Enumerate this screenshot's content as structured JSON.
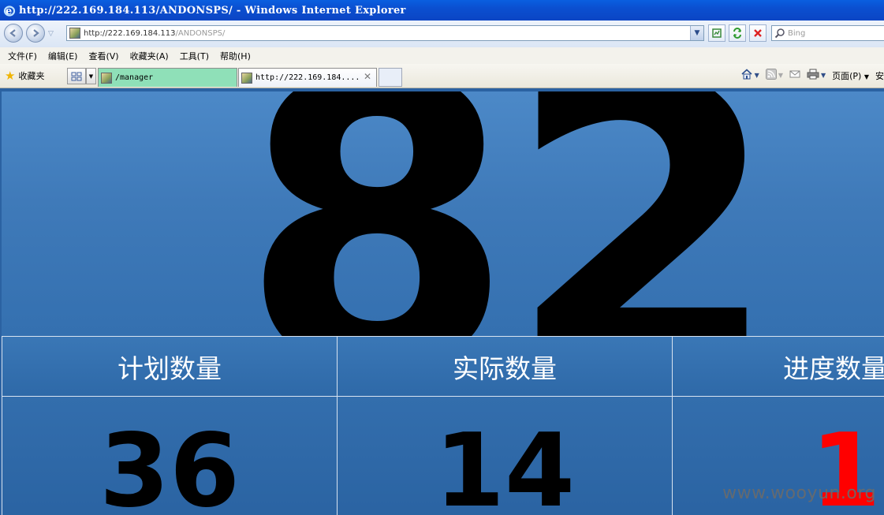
{
  "window": {
    "title": "http://222.169.184.113/ANDONSPS/ - Windows Internet Explorer"
  },
  "address_bar": {
    "url_host": "http://222.169.184.113",
    "url_path": "/ANDONSPS/",
    "search_placeholder": "Bing"
  },
  "menu": {
    "items": [
      "文件(F)",
      "编辑(E)",
      "查看(V)",
      "收藏夹(A)",
      "工具(T)",
      "帮助(H)"
    ]
  },
  "tabbar": {
    "favorites_label": "收藏夹",
    "tabs": [
      {
        "label": "/manager"
      },
      {
        "label": "http://222.169.184...."
      }
    ],
    "page_menu_label": "页面(P)",
    "safety_menu_label": "安"
  },
  "dashboard": {
    "big_number": "82",
    "headers": [
      "计划数量",
      "实际数量",
      "进度数量"
    ],
    "values": [
      "36",
      "14",
      "1"
    ],
    "value_colors": [
      "#000000",
      "#000000",
      "#ff0000"
    ]
  },
  "watermark": "www.wooyun.org",
  "colors": {
    "titlebar": "#0b4fd0",
    "content_bg": "#2b62a2",
    "tab_active": "#8fe0b8",
    "alert_red": "#ff0000"
  }
}
